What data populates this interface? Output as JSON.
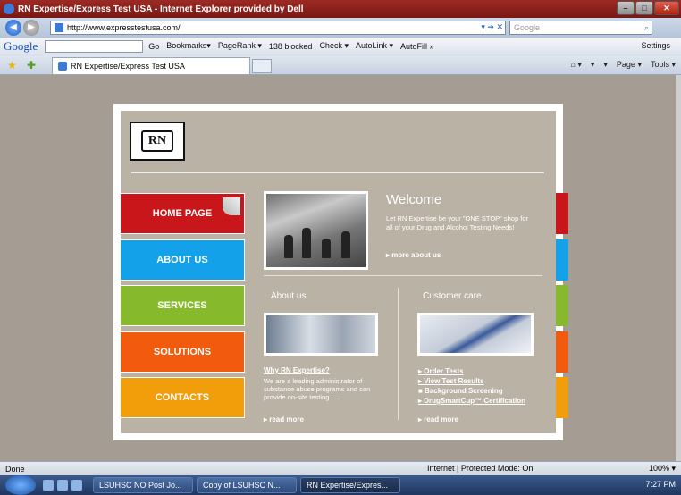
{
  "window": {
    "title": "RN Expertise/Express Test USA - Internet Explorer provided by Dell",
    "controls": [
      "–",
      "□",
      "✕"
    ]
  },
  "address": {
    "url": "http://www.expresstestusa.com/",
    "search_placeholder": "Google"
  },
  "google_toolbar": {
    "logo": "Google",
    "go": "Go",
    "bookmarks": "Bookmarks▾",
    "pagerank": "PageRank ▾",
    "blocked": "138 blocked",
    "check": "Check ▾",
    "autolink": "AutoLink ▾",
    "autofill": "AutoFill »",
    "settings": "Settings"
  },
  "tabs": {
    "active": "RN Expertise/Express Test USA"
  },
  "commands": {
    "home": "⌂ ▾",
    "feeds": "▾",
    "print": "▾",
    "page": "Page ▾",
    "tools": "Tools ▾"
  },
  "site": {
    "logo": "RN",
    "nav": [
      "HOME PAGE",
      "ABOUT US",
      "SERVICES",
      "SOLUTIONS",
      "CONTACTS"
    ],
    "welcome": {
      "title": "Welcome",
      "text": "Let RN Expertise be your \"ONE STOP\" shop for all of your Drug and Alcohol Testing Needs!",
      "more": "▸ more about us"
    },
    "about": {
      "title": "About us",
      "link": "Why RN Expertise?",
      "text": "We are a leading administrator of substance abuse programs and can provide on-site testing......",
      "more": "▸ read more"
    },
    "care": {
      "title": "Customer care",
      "items": [
        "▸ Order Tests",
        "▸ View Test Results",
        "■ Background Screening",
        "▸ DrugSmartCup™ Certification"
      ],
      "more": "▸ read more"
    }
  },
  "status": {
    "left": "Done",
    "zone": "Internet | Protected Mode: On",
    "zoom": "100% ▾"
  },
  "taskbar": {
    "tasks": [
      "LSUHSC NO Post Jo...",
      "Copy of LSUHSC N...",
      "RN Expertise/Expres..."
    ],
    "time": "7:27 PM"
  }
}
